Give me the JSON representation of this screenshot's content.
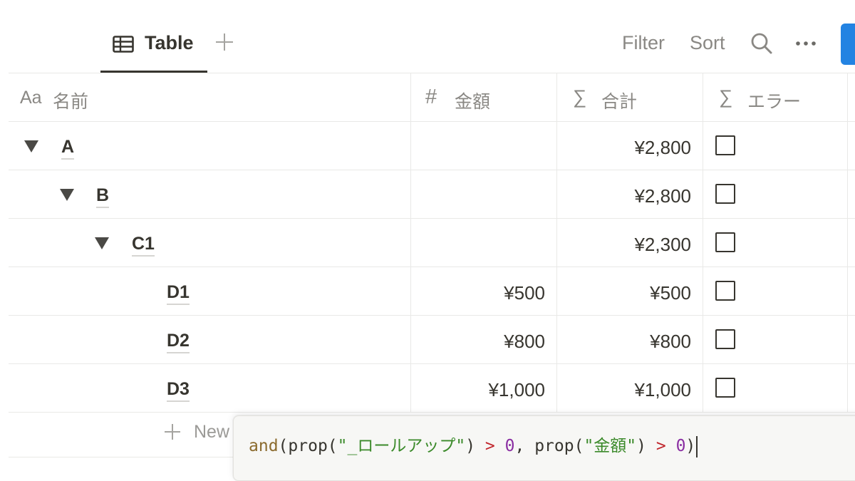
{
  "toolbar": {
    "tab_label": "Table",
    "tab_icon": "table-icon",
    "add_view_icon": "plus-icon",
    "filter_label": "Filter",
    "sort_label": "Sort",
    "search_icon": "search-icon",
    "more_icon": "more-dots-icon",
    "new_button_color": "#2383e2"
  },
  "table": {
    "columns": [
      {
        "icon": "Aa",
        "label": "名前"
      },
      {
        "icon": "#",
        "label": "金額"
      },
      {
        "icon": "∑",
        "label": "合計"
      },
      {
        "icon": "∑",
        "label": "エラー"
      }
    ],
    "rows": [
      {
        "name": "A",
        "expanded": true,
        "level": 0,
        "amount": "",
        "total": "¥2,800",
        "error": false
      },
      {
        "name": "B",
        "expanded": true,
        "level": 1,
        "amount": "",
        "total": "¥2,800",
        "error": false
      },
      {
        "name": "C1",
        "expanded": true,
        "level": 2,
        "amount": "",
        "total": "¥2,300",
        "error": false
      },
      {
        "name": "D1",
        "expanded": false,
        "level": 3,
        "amount": "¥500",
        "total": "¥500",
        "error": false
      },
      {
        "name": "D2",
        "expanded": false,
        "level": 3,
        "amount": "¥800",
        "total": "¥800",
        "error": false
      },
      {
        "name": "D3",
        "expanded": false,
        "level": 3,
        "amount": "¥1,000",
        "total": "¥1,000",
        "error": false
      }
    ],
    "new_row_label": "New"
  },
  "formula": {
    "fn_and": "and",
    "fn_prop1": "prop",
    "arg1": "\"_ロールアップ\"",
    "op1": ">",
    "num1": "0",
    "fn_prop2": "prop",
    "arg2": "\"金額\"",
    "op2": ">",
    "num2": "0"
  }
}
